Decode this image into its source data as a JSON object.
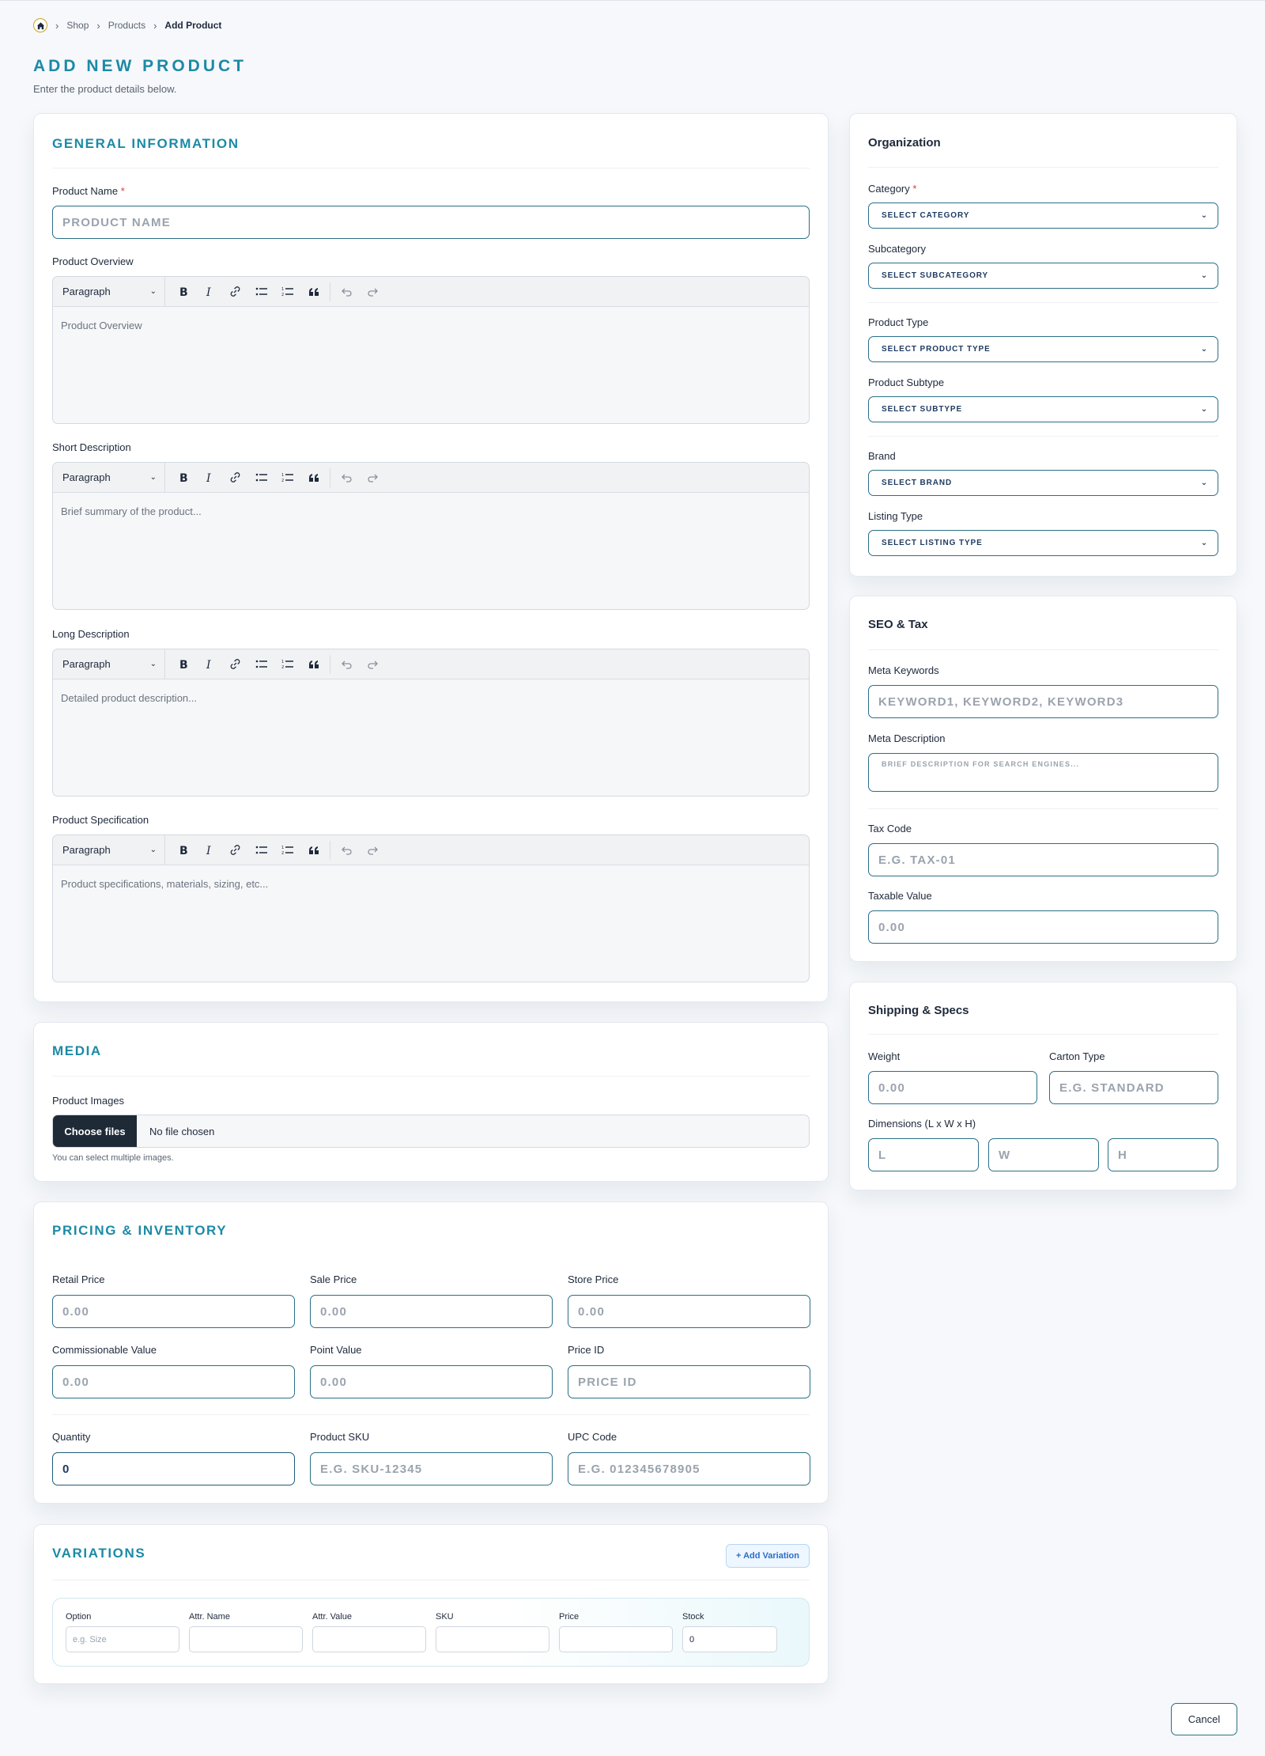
{
  "breadcrumb": {
    "items": [
      "Shop",
      "Products"
    ],
    "current": "Add Product"
  },
  "page": {
    "title": "ADD NEW PRODUCT",
    "subtitle": "Enter the product details below."
  },
  "general": {
    "title": "GENERAL INFORMATION",
    "product_name_label": "Product Name",
    "required_mark": "*",
    "product_name_placeholder": "PRODUCT NAME",
    "editors": [
      {
        "label": "Product Overview",
        "format": "Paragraph",
        "placeholder": "Product Overview"
      },
      {
        "label": "Short Description",
        "format": "Paragraph",
        "placeholder": "Brief summary of the product..."
      },
      {
        "label": "Long Description",
        "format": "Paragraph",
        "placeholder": "Detailed product description..."
      },
      {
        "label": "Product Specification",
        "format": "Paragraph",
        "placeholder": "Product specifications, materials, sizing, etc..."
      }
    ]
  },
  "media": {
    "title": "MEDIA",
    "images_label": "Product Images",
    "choose_button": "Choose files",
    "no_file": "No file chosen",
    "hint": "You can select multiple images."
  },
  "pricing": {
    "title": "PRICING & INVENTORY",
    "retail_label": "Retail Price",
    "retail_placeholder": "0.00",
    "sale_label": "Sale Price",
    "sale_placeholder": "0.00",
    "store_label": "Store Price",
    "store_placeholder": "0.00",
    "commission_label": "Commissionable Value",
    "commission_placeholder": "0.00",
    "point_label": "Point Value",
    "point_placeholder": "0.00",
    "priceid_label": "Price ID",
    "priceid_placeholder": "PRICE ID",
    "quantity_label": "Quantity",
    "quantity_value": "0",
    "sku_label": "Product SKU",
    "sku_placeholder": "E.G. SKU-12345",
    "upc_label": "UPC Code",
    "upc_placeholder": "E.G. 012345678905"
  },
  "variations": {
    "title": "VARIATIONS",
    "add_button": "+ Add Variation",
    "columns": [
      "Option",
      "Attr. Name",
      "Attr. Value",
      "SKU",
      "Price",
      "Stock"
    ],
    "option_placeholder": "e.g. Size",
    "stock_value": "0"
  },
  "organization": {
    "title": "Organization",
    "category_label": "Category",
    "category_value": "SELECT CATEGORY",
    "subcategory_label": "Subcategory",
    "subcategory_value": "SELECT SUBCATEGORY",
    "product_type_label": "Product Type",
    "product_type_value": "SELECT PRODUCT TYPE",
    "product_subtype_label": "Product Subtype",
    "product_subtype_value": "SELECT SUBTYPE",
    "brand_label": "Brand",
    "brand_value": "SELECT BRAND",
    "listing_label": "Listing Type",
    "listing_value": "SELECT LISTING TYPE"
  },
  "seo": {
    "title": "SEO & Tax",
    "keywords_label": "Meta Keywords",
    "keywords_placeholder": "KEYWORD1, KEYWORD2, KEYWORD3",
    "description_label": "Meta Description",
    "description_placeholder": "BRIEF DESCRIPTION FOR SEARCH ENGINES...",
    "tax_code_label": "Tax Code",
    "tax_code_placeholder": "E.G. TAX-01",
    "taxable_label": "Taxable Value",
    "taxable_placeholder": "0.00"
  },
  "shipping": {
    "title": "Shipping & Specs",
    "weight_label": "Weight",
    "weight_placeholder": "0.00",
    "carton_label": "Carton Type",
    "carton_placeholder": "E.G. STANDARD",
    "dimensions_label": "Dimensions (L x W x H)",
    "l_placeholder": "L",
    "w_placeholder": "W",
    "h_placeholder": "H"
  },
  "footer": {
    "cancel": "Cancel"
  },
  "colors": {
    "accent": "#1c8aa6",
    "border": "#2a6f86",
    "dark": "#1f2a37",
    "required": "#e03a3a"
  }
}
